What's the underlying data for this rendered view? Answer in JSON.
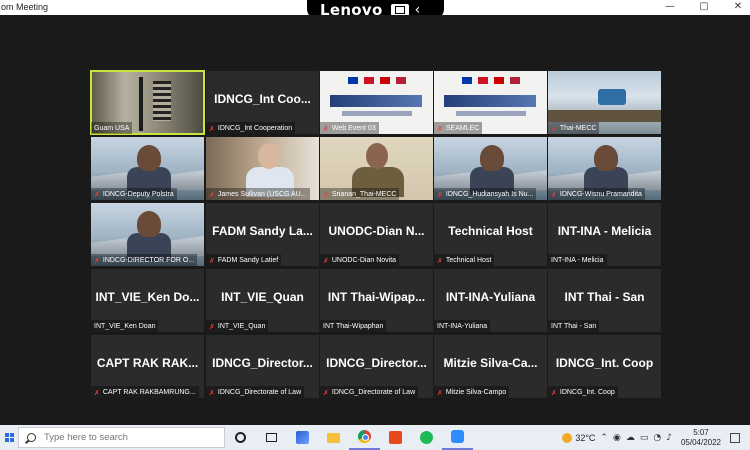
{
  "window": {
    "title": "om Meeting",
    "controls": [
      "—",
      "▢",
      "✕"
    ]
  },
  "overlay": {
    "brand": "Lenovo",
    "chevron": "‹"
  },
  "tiles": [
    {
      "caption": "Guam USA",
      "kind": "guam",
      "muted": false,
      "active": true
    },
    {
      "name": "IDNCG_Int Coo...",
      "caption": "IDNCG_Int Cooperation",
      "kind": "name",
      "muted": true
    },
    {
      "caption": "Web Event 03",
      "kind": "slide",
      "muted": true
    },
    {
      "caption": "SEAMLEC",
      "kind": "slide",
      "muted": true
    },
    {
      "caption": "Thai-MECC",
      "kind": "room",
      "muted": true
    },
    {
      "caption": "IDNCG-Deputy Polstra",
      "kind": "seamlec",
      "muted": true
    },
    {
      "caption": "James Sullivan (USCG AU...",
      "kind": "office",
      "muted": true
    },
    {
      "caption": "Srianan_Thai-MECC",
      "kind": "beige",
      "muted": true
    },
    {
      "caption": "IDNCG_Hudiansyah Is Nu...",
      "kind": "seamlec",
      "muted": true
    },
    {
      "caption": "IDNCG-Wisnu Pramandita",
      "kind": "seamlec",
      "muted": true
    },
    {
      "caption": "INDCG-DIRECTOR FOR O...",
      "kind": "seamlec",
      "muted": true
    },
    {
      "name": "FADM Sandy La...",
      "caption": "FADM Sandy Latief",
      "kind": "name",
      "muted": true
    },
    {
      "name": "UNODC-Dian N...",
      "caption": "UNODC-Dian Novita",
      "kind": "name",
      "muted": true
    },
    {
      "name": "Technical Host",
      "caption": "Technical Host",
      "kind": "name",
      "muted": true
    },
    {
      "name": "INT-INA - Melicia",
      "caption": "INT-INA - Melicia",
      "kind": "name",
      "muted": false
    },
    {
      "name": "INT_VIE_Ken Do...",
      "caption": "INT_VIE_Ken Doan",
      "kind": "name",
      "muted": false
    },
    {
      "name": "INT_VIE_Quan",
      "caption": "INT_VIE_Quan",
      "kind": "name",
      "muted": true
    },
    {
      "name": "INT Thai-Wipap...",
      "caption": "INT Thai-Wipaphan",
      "kind": "name",
      "muted": false
    },
    {
      "name": "INT-INA-Yuliana",
      "caption": "INT-INA-Yuliana",
      "kind": "name",
      "muted": false
    },
    {
      "name": "INT Thai - San",
      "caption": "INT Thai - San",
      "kind": "name",
      "muted": false
    },
    {
      "name": "CAPT RAK RAK...",
      "caption": "CAPT RAK RAKBAMRUNG...",
      "kind": "name",
      "muted": true
    },
    {
      "name": "IDNCG_Director...",
      "caption": "IDNCG_Directorate of Law",
      "kind": "name",
      "muted": true
    },
    {
      "name": "IDNCG_Director...",
      "caption": "IDNCG_Directorate of Law",
      "kind": "name",
      "muted": true
    },
    {
      "name": "Mitzie Silva-Ca...",
      "caption": "Mitzie Silva-Campo",
      "kind": "name",
      "muted": true
    },
    {
      "name": "IDNCG_Int. Coop",
      "caption": "IDNCG_Int. Coop",
      "kind": "name",
      "muted": true
    }
  ],
  "taskbar": {
    "search_placeholder": "Type here to search",
    "apps": [
      "cortana-icon",
      "task-view-icon",
      "photo-app-icon",
      "file-explorer-icon",
      "chrome-icon",
      "office-icon",
      "spotify-icon",
      "zoom-icon"
    ],
    "temperature": "32°C",
    "time": "5:07",
    "date": "05/04/2022"
  },
  "colors": {
    "active_tile_border": "#c9e43a",
    "muted_icon": "#e0403a",
    "meeting_bg": "#1a1a1a",
    "taskbar_bg": "#e9eef5"
  }
}
